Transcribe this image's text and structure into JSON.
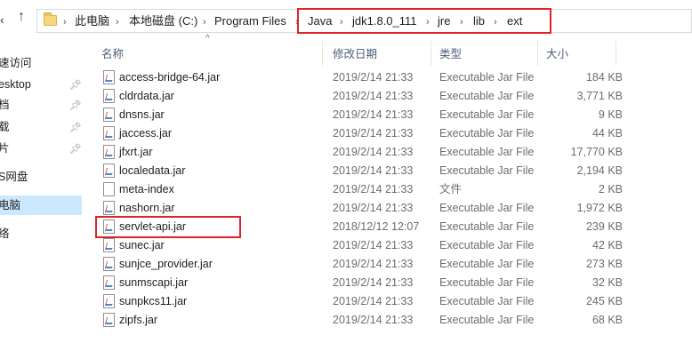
{
  "address_bar": {
    "breadcrumbs": [
      "此电脑",
      "本地磁盘 (C:)",
      "Program Files",
      "Java",
      "jdk1.8.0_111",
      "jre",
      "lib",
      "ext"
    ],
    "separator": "›"
  },
  "nav_icons": {
    "back": "chevron-left-icon",
    "up": "arrow-up-icon"
  },
  "nav_pane": {
    "items": [
      {
        "label": "速访问",
        "pinned": false
      },
      {
        "label": "esktop",
        "pinned": true
      },
      {
        "label": "档",
        "pinned": true
      },
      {
        "label": "载",
        "pinned": true
      },
      {
        "label": "片",
        "pinned": true
      },
      {
        "label": "S网盘",
        "pinned": false
      },
      {
        "label": "电脑",
        "pinned": false,
        "selected": true
      },
      {
        "label": "络",
        "pinned": false
      }
    ]
  },
  "columns": {
    "name": "名称",
    "date": "修改日期",
    "type": "类型",
    "size": "大小"
  },
  "files": [
    {
      "name": "access-bridge-64.jar",
      "date": "2019/2/14 21:33",
      "type": "Executable Jar File",
      "size": "184 KB",
      "icon": "jar-file-icon"
    },
    {
      "name": "cldrdata.jar",
      "date": "2019/2/14 21:33",
      "type": "Executable Jar File",
      "size": "3,771 KB",
      "icon": "jar-file-icon"
    },
    {
      "name": "dnsns.jar",
      "date": "2019/2/14 21:33",
      "type": "Executable Jar File",
      "size": "9 KB",
      "icon": "jar-file-icon"
    },
    {
      "name": "jaccess.jar",
      "date": "2019/2/14 21:33",
      "type": "Executable Jar File",
      "size": "44 KB",
      "icon": "jar-file-icon"
    },
    {
      "name": "jfxrt.jar",
      "date": "2019/2/14 21:33",
      "type": "Executable Jar File",
      "size": "17,770 KB",
      "icon": "jar-file-icon"
    },
    {
      "name": "localedata.jar",
      "date": "2019/2/14 21:33",
      "type": "Executable Jar File",
      "size": "2,194 KB",
      "icon": "jar-file-icon"
    },
    {
      "name": "meta-index",
      "date": "2019/2/14 21:33",
      "type": "文件",
      "size": "2 KB",
      "icon": "blank-file-icon"
    },
    {
      "name": "nashorn.jar",
      "date": "2019/2/14 21:33",
      "type": "Executable Jar File",
      "size": "1,972 KB",
      "icon": "jar-file-icon"
    },
    {
      "name": "servlet-api.jar",
      "date": "2018/12/12 12:07",
      "type": "Executable Jar File",
      "size": "239 KB",
      "icon": "jar-file-icon"
    },
    {
      "name": "sunec.jar",
      "date": "2019/2/14 21:33",
      "type": "Executable Jar File",
      "size": "42 KB",
      "icon": "jar-file-icon"
    },
    {
      "name": "sunjce_provider.jar",
      "date": "2019/2/14 21:33",
      "type": "Executable Jar File",
      "size": "273 KB",
      "icon": "jar-file-icon"
    },
    {
      "name": "sunmscapi.jar",
      "date": "2019/2/14 21:33",
      "type": "Executable Jar File",
      "size": "32 KB",
      "icon": "jar-file-icon"
    },
    {
      "name": "sunpkcs11.jar",
      "date": "2019/2/14 21:33",
      "type": "Executable Jar File",
      "size": "245 KB",
      "icon": "jar-file-icon"
    },
    {
      "name": "zipfs.jar",
      "date": "2019/2/14 21:33",
      "type": "Executable Jar File",
      "size": "68 KB",
      "icon": "jar-file-icon"
    }
  ],
  "highlights": {
    "color": "#e0222b"
  }
}
